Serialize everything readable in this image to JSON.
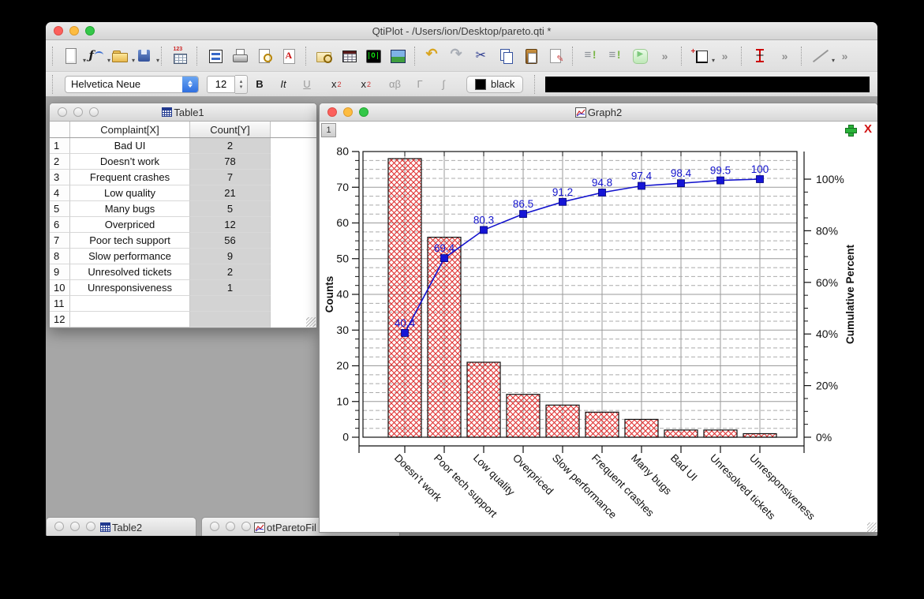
{
  "window": {
    "title": "QtiPlot - /Users/ion/Desktop/pareto.qti *"
  },
  "toolbar": {
    "groups": [
      [
        {
          "n": "new-window",
          "dd": 1
        },
        {
          "n": "plot-function",
          "dd": 1
        },
        {
          "n": "open-file",
          "dd": 1
        },
        {
          "n": "save-file",
          "dd": 1
        }
      ],
      [
        {
          "n": "import-table"
        }
      ],
      [
        {
          "n": "tile-windows"
        },
        {
          "n": "print"
        },
        {
          "n": "print-preview"
        },
        {
          "n": "export-pdf"
        }
      ],
      [
        {
          "n": "project-explorer"
        },
        {
          "n": "results-log"
        },
        {
          "n": "plot-wizard"
        },
        {
          "n": "image-plot"
        }
      ],
      [
        {
          "n": "undo"
        },
        {
          "n": "redo"
        },
        {
          "n": "cut"
        },
        {
          "n": "copy"
        },
        {
          "n": "paste"
        },
        {
          "n": "clear-selection"
        }
      ],
      [
        {
          "n": "insert-row"
        },
        {
          "n": "delete-row"
        },
        {
          "n": "run-script"
        },
        {
          "n": "overflow",
          "t": "»"
        }
      ],
      [
        {
          "n": "new-layer",
          "dd": 1
        },
        {
          "n": "overflow",
          "t": "»"
        }
      ],
      [
        {
          "n": "error-bars"
        },
        {
          "n": "overflow",
          "t": "»"
        }
      ],
      [
        {
          "n": "draw-line",
          "dd": 1
        },
        {
          "n": "overflow",
          "t": "»"
        }
      ]
    ]
  },
  "format_toolbar": {
    "font_name": "Helvetica Neue",
    "font_size": "12",
    "bold": "B",
    "italic": "It",
    "underline": "U",
    "sup_base": "x",
    "sup_exp": "2",
    "sub_base": "x",
    "sub_sub": "2",
    "greek": "αβ",
    "gamma": "Γ",
    "integral": "∫",
    "color_button_label": "black"
  },
  "table_window": {
    "title": "Table1",
    "col_headers": [
      "Complaint[X]",
      "Count[Y]"
    ],
    "rows": [
      {
        "n": "1",
        "complaint": "Bad UI",
        "count": "2"
      },
      {
        "n": "2",
        "complaint": "Doesn’t work",
        "count": "78"
      },
      {
        "n": "3",
        "complaint": "Frequent crashes",
        "count": "7"
      },
      {
        "n": "4",
        "complaint": "Low quality",
        "count": "21"
      },
      {
        "n": "5",
        "complaint": "Many bugs",
        "count": "5"
      },
      {
        "n": "6",
        "complaint": "Overpriced",
        "count": "12"
      },
      {
        "n": "7",
        "complaint": "Poor tech support",
        "count": "56"
      },
      {
        "n": "8",
        "complaint": "Slow performance",
        "count": "9"
      },
      {
        "n": "9",
        "complaint": "Unresolved tickets",
        "count": "2"
      },
      {
        "n": "10",
        "complaint": "Unresponsiveness",
        "count": "1"
      },
      {
        "n": "11",
        "complaint": "",
        "count": ""
      },
      {
        "n": "12",
        "complaint": "",
        "count": ""
      }
    ]
  },
  "graph_window": {
    "title": "Graph2",
    "layer_tab": "1"
  },
  "minimized_windows": [
    {
      "title": "Table2"
    },
    {
      "title": "otParetoFil"
    }
  ],
  "chart_data": {
    "type": "pareto",
    "categories": [
      "Doesn’t work",
      "Poor tech support",
      "Low quality",
      "Overpriced",
      "Slow performance",
      "Frequent crashes",
      "Many bugs",
      "Bad UI",
      "Unresolved tickets",
      "Unresponsiveness"
    ],
    "series": [
      {
        "name": "Counts",
        "type": "bar",
        "values": [
          78,
          56,
          21,
          12,
          9,
          7,
          5,
          2,
          2,
          1
        ]
      },
      {
        "name": "Cumulative Percent",
        "type": "line",
        "values": [
          40.4,
          69.4,
          80.3,
          86.5,
          91.2,
          94.8,
          97.4,
          98.4,
          99.5,
          100
        ],
        "point_labels": [
          "40.4",
          "69.4",
          "80.3",
          "86.5",
          "91.2",
          "94.8",
          "97.4",
          "98.4",
          "99.5",
          "100"
        ]
      }
    ],
    "left_axis": {
      "label": "Counts",
      "min": 0,
      "max": 80,
      "major_ticks": [
        0,
        10,
        20,
        30,
        40,
        50,
        60,
        70,
        80
      ],
      "minor_step": 2.5
    },
    "right_axis": {
      "label": "Cumulative Percent",
      "tick_labels": [
        "0%",
        "20%",
        "40%",
        "60%",
        "80%",
        "100%"
      ],
      "major_step": 20,
      "minor_step": 5
    },
    "grid": true,
    "legend_position": "none",
    "colors": {
      "bar_hatch": "#e03131",
      "bar_stroke": "#111111",
      "line": "#1212cd",
      "marker_fill": "#1515d6",
      "marker_stroke": "#00007a",
      "point_label": "#1414cc",
      "grid_major": "#9a9a9a",
      "grid_minor": "#ababab",
      "axis": "#111111"
    }
  }
}
